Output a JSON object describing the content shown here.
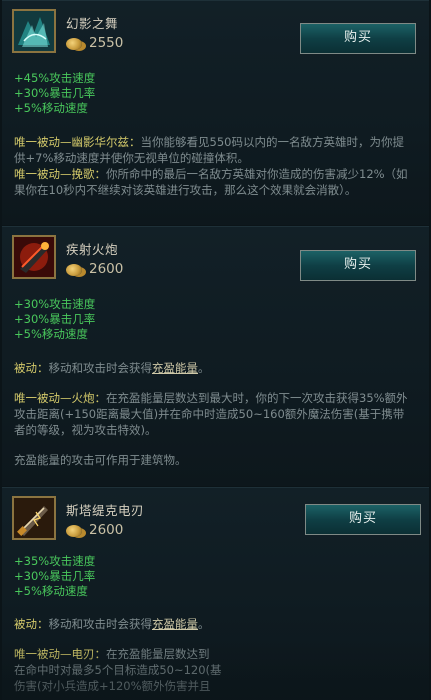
{
  "items": [
    {
      "name": "幻影之舞",
      "price": "2550",
      "buy_label": "购买",
      "icon": "phantom-dancer-icon",
      "stats": [
        "+45%攻击速度",
        "+30%暴击几率",
        "+5%移动速度"
      ],
      "passive1_title": "唯一被动—幽影华尔兹：",
      "passive1_text": "当你能够看见550码以内的一名敌方英雄时，为你提供+7%移动速度并使你无视单位的碰撞体积。",
      "passive2_title": "唯一被动—挽歌：",
      "passive2_text": "你所命中的最后一名敌方英雄对你造成的伤害减少12%（如果你在10秒内不继续对该英雄进行攻击，那么这个效果就会消散）。"
    },
    {
      "name": "疾射火炮",
      "price": "2600",
      "buy_label": "购买",
      "icon": "rapid-firecannon-icon",
      "stats": [
        "+30%攻击速度",
        "+30%暴击几率",
        "+5%移动速度"
      ],
      "passive_label": "被动：",
      "passive_text": "移动和攻击时会获得",
      "passive_link": "充盈能量",
      "passive_end": "。",
      "unique_title": "唯一被动—火炮：",
      "unique_text": "在充盈能量层数达到最大时，你的下一次攻击获得35%额外攻击距离(+150距离最大值)并在命中时造成50~160额外魔法伤害(基于携带者的等级，视为攻击特效)。",
      "note": "充盈能量的攻击可作用于建筑物。"
    },
    {
      "name": "斯塔缇克电刃",
      "price": "2600",
      "buy_label": "购买",
      "icon": "statikk-shiv-icon",
      "stats": [
        "+35%攻击速度",
        "+30%暴击几率",
        "+5%移动速度"
      ],
      "passive_label": "被动：",
      "passive_text": "移动和攻击时会获得",
      "passive_link": "充盈能量",
      "passive_end": "。",
      "unique_title": "唯一被动—电刃：",
      "unique_line1": "在充盈能量层数达到",
      "unique_line2": "在命中时对最多5个目标造成50~120(基",
      "unique_line3": "伤害(对小兵造成+120%额外伤害并且"
    }
  ]
}
